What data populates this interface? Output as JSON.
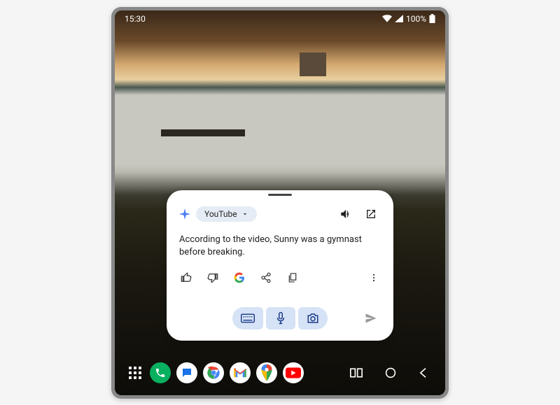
{
  "status": {
    "time": "15:30",
    "battery_pct": "100%"
  },
  "assistant": {
    "chip_label": "YouTube",
    "response_text": "According to the video, Sunny was a gymnast before breaking."
  },
  "taskbar": {
    "apps": [
      "app-drawer",
      "phone",
      "messages",
      "chrome",
      "gmail",
      "maps",
      "youtube"
    ]
  }
}
